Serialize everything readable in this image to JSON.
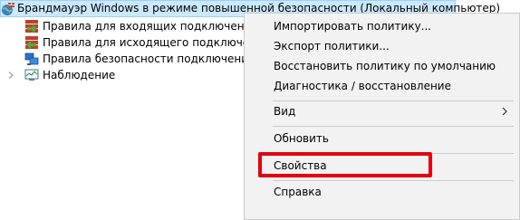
{
  "tree": {
    "root_label": "Брандмауэр Windows в режиме повышенной безопасности (Локальный компьютер)",
    "items": [
      {
        "label": "Правила для входящих подключений"
      },
      {
        "label": "Правила для исходящего подключения"
      },
      {
        "label": "Правила безопасности подключения"
      },
      {
        "label": "Наблюдение"
      }
    ]
  },
  "context_menu": {
    "items": [
      {
        "label": "Импортировать политику..."
      },
      {
        "label": "Экспорт политики..."
      },
      {
        "label": "Восстановить политику по умолчанию"
      },
      {
        "label": "Диагностика / восстановление"
      },
      {
        "label": "Вид",
        "has_submenu": true
      },
      {
        "label": "Обновить"
      },
      {
        "label": "Свойства",
        "highlighted": true
      },
      {
        "label": "Справка"
      }
    ]
  },
  "colors": {
    "selection_bg": "#cce8ff",
    "selection_border": "#99d1ff",
    "menu_bg": "#f2f2f2",
    "highlight_box": "#e3000f"
  }
}
